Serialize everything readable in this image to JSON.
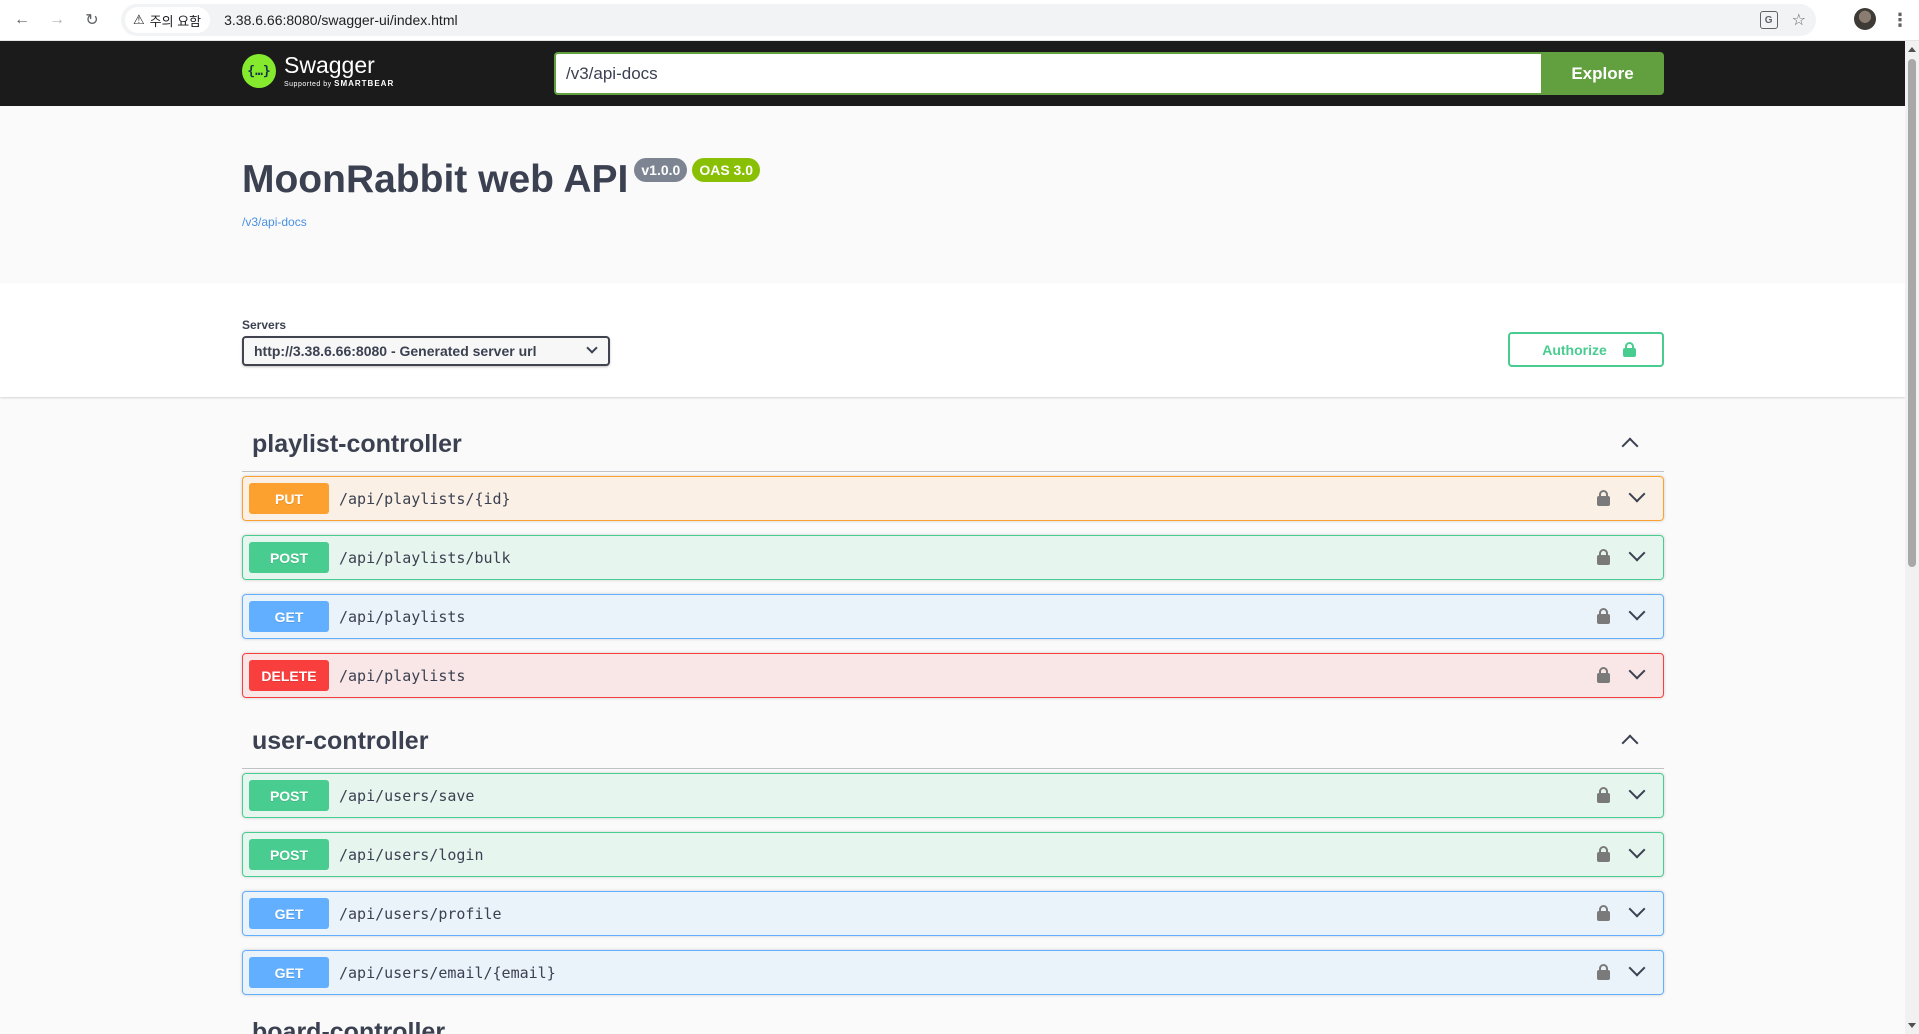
{
  "browser": {
    "security_chip": "주의 요함",
    "url": "3.38.6.66:8080/swagger-ui/index.html"
  },
  "topbar": {
    "logo_name": "Swagger",
    "logo_sub_prefix": "Supported by",
    "logo_sub_brand": "SMARTBEAR",
    "spec_url_value": "/v3/api-docs",
    "explore_label": "Explore"
  },
  "info": {
    "title": "MoonRabbit web API",
    "version_badge": "v1.0.0",
    "oas_badge": "OAS 3.0",
    "spec_link": "/v3/api-docs"
  },
  "servers": {
    "label": "Servers",
    "selected": "http://3.38.6.66:8080 - Generated server url",
    "authorize_label": "Authorize"
  },
  "tags": [
    {
      "name": "playlist-controller",
      "operations": [
        {
          "method": "PUT",
          "path": "/api/playlists/{id}"
        },
        {
          "method": "POST",
          "path": "/api/playlists/bulk"
        },
        {
          "method": "GET",
          "path": "/api/playlists"
        },
        {
          "method": "DELETE",
          "path": "/api/playlists"
        }
      ]
    },
    {
      "name": "user-controller",
      "operations": [
        {
          "method": "POST",
          "path": "/api/users/save"
        },
        {
          "method": "POST",
          "path": "/api/users/login"
        },
        {
          "method": "GET",
          "path": "/api/users/profile"
        },
        {
          "method": "GET",
          "path": "/api/users/email/{email}"
        }
      ]
    }
  ],
  "partially_visible_tag": "board-controller",
  "colors": {
    "put": "#fca130",
    "post": "#49cc90",
    "get": "#61affe",
    "delete": "#f93e3e",
    "explore": "#62a03f",
    "topbar": "#1b1b1b"
  }
}
